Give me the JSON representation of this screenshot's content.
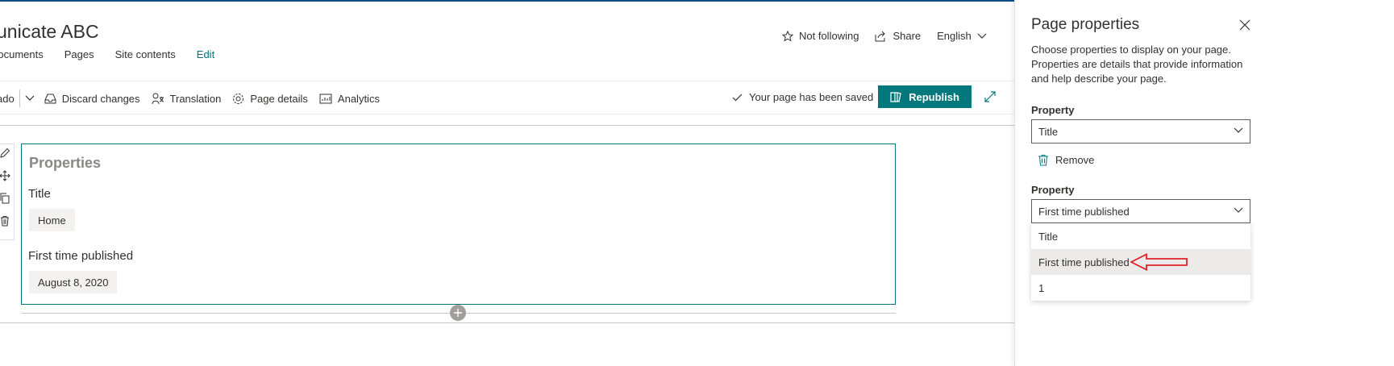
{
  "site": {
    "title": "unicate ABC",
    "nav": [
      "Documents",
      "Pages",
      "Site contents",
      "Edit"
    ]
  },
  "header_actions": {
    "follow": "Not following",
    "share": "Share",
    "language": "English"
  },
  "command_bar": {
    "undo": "ado",
    "discard": "Discard changes",
    "translation": "Translation",
    "page_details": "Page details",
    "analytics": "Analytics",
    "status": "Your page has been saved",
    "republish": "Republish"
  },
  "webpart": {
    "title": "Properties",
    "fields": [
      {
        "label": "Title",
        "value": "Home"
      },
      {
        "label": "First time published",
        "value": "August 8, 2020"
      }
    ]
  },
  "panel": {
    "title": "Page properties",
    "description": "Choose properties to display on your page. Properties are details that provide information and help describe your page.",
    "property_label": "Property",
    "property1_value": "Title",
    "remove_label": "Remove",
    "property2_value": "First time published",
    "options": [
      "Title",
      "First time published",
      "1"
    ],
    "selected_option": "First time published"
  },
  "colors": {
    "accent": "#03787c",
    "topbar": "#0f4c81",
    "annotation_arrow": "#e0202a"
  }
}
